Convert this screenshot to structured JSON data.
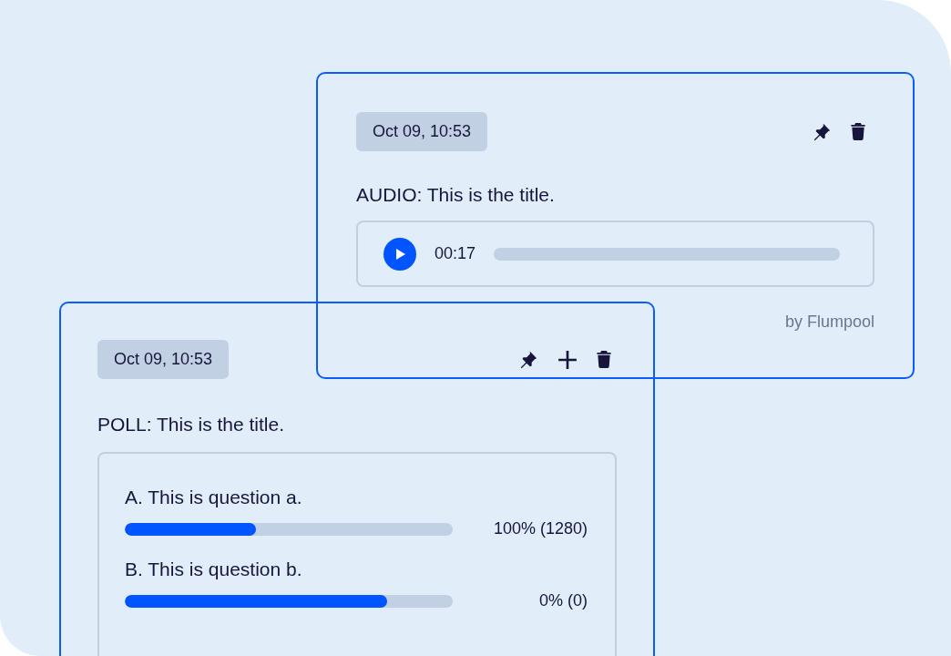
{
  "cards": [
    {
      "kind": "audio",
      "date": "Oct 09, 10:53",
      "title": "AUDIO: This is the title.",
      "player": {
        "time": "00:17"
      },
      "author": "by Flumpool"
    },
    {
      "kind": "poll",
      "date": "Oct 09, 10:53",
      "title": "POLL: This is the title.",
      "options": [
        {
          "label": "A. This is question a.",
          "level": 0.4,
          "result": "100% (1280)"
        },
        {
          "label": "B. This is question b.",
          "level": 0.8,
          "result": "0% (0)"
        }
      ]
    }
  ]
}
